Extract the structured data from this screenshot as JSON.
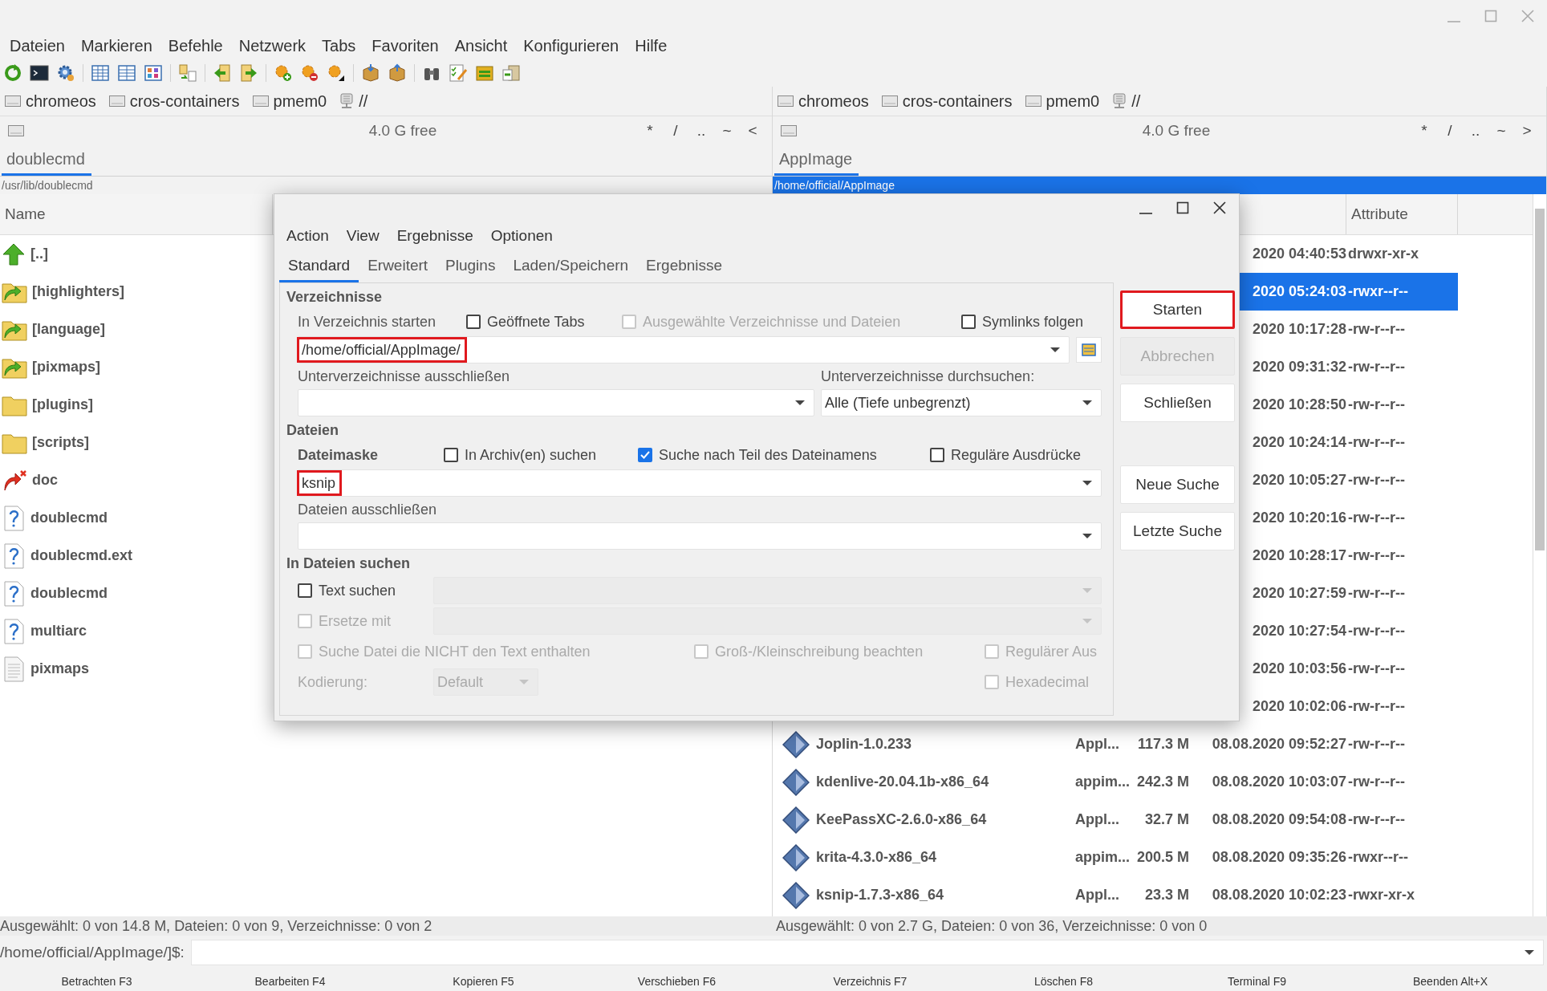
{
  "menu": [
    "Dateien",
    "Markieren",
    "Befehle",
    "Netzwerk",
    "Tabs",
    "Favoriten",
    "Ansicht",
    "Konfigurieren",
    "Hilfe"
  ],
  "panels": [
    {
      "active": false,
      "drives": [
        {
          "label": "chromeos",
          "kind": "disk"
        },
        {
          "label": "cros-containers",
          "kind": "disk"
        },
        {
          "label": "pmem0",
          "kind": "disk"
        },
        {
          "label": "//",
          "kind": "network"
        }
      ],
      "free": "4.0 G free",
      "nav_buttons": [
        "*",
        "/",
        "..",
        "~",
        "<"
      ],
      "tab": "doublecmd",
      "path": "/usr/lib/doublecmd",
      "column": "Name",
      "status": "Ausgewählt: 0 von 14.8 M, Dateien: 0 von 9, Verzeichnisse: 0 von 2",
      "rows": [
        {
          "kind": "parent",
          "name": "[..]",
          "selected": false
        },
        {
          "kind": "folder-link",
          "name": "[highlighters]",
          "selected": false
        },
        {
          "kind": "folder-link",
          "name": "[language]",
          "selected": false
        },
        {
          "kind": "folder-link",
          "name": "[pixmaps]",
          "selected": false
        },
        {
          "kind": "folder",
          "name": "[plugins]",
          "selected": false
        },
        {
          "kind": "folder",
          "name": "[scripts]",
          "selected": false
        },
        {
          "kind": "broken-link",
          "name": "doc",
          "selected": false
        },
        {
          "kind": "file",
          "name": "doublecmd",
          "selected": false
        },
        {
          "kind": "file",
          "name": "doublecmd.ext",
          "selected": false
        },
        {
          "kind": "file",
          "name": "doublecmd",
          "selected": false
        },
        {
          "kind": "file",
          "name": "multiarc",
          "selected": false
        },
        {
          "kind": "text-file",
          "name": "pixmaps",
          "selected": false
        }
      ]
    },
    {
      "active": true,
      "drives": [
        {
          "label": "chromeos",
          "kind": "disk"
        },
        {
          "label": "cros-containers",
          "kind": "disk"
        },
        {
          "label": "pmem0",
          "kind": "disk"
        },
        {
          "label": "//",
          "kind": "network"
        }
      ],
      "free": "4.0 G free",
      "nav_buttons": [
        "*",
        "/",
        "..",
        "~",
        ">"
      ],
      "tab": "AppImage",
      "path": "/home/official/AppImage",
      "column": "Attribute",
      "status": "Ausgewählt: 0 von 2.7 G, Dateien: 0 von 36, Verzeichnisse: 0 von 0",
      "rows": [
        {
          "kind": "covered",
          "modified": "2020 04:40:53",
          "attributes": "drwxr-xr-x",
          "selected": false
        },
        {
          "kind": "covered",
          "modified": "2020 05:24:03",
          "attributes": "-rwxr--r--",
          "selected": true
        },
        {
          "kind": "covered",
          "modified": "2020 10:17:28",
          "attributes": "-rw-r--r--",
          "selected": false
        },
        {
          "kind": "covered",
          "modified": "2020 09:31:32",
          "attributes": "-rw-r--r--",
          "selected": false
        },
        {
          "kind": "covered",
          "modified": "2020 10:28:50",
          "attributes": "-rw-r--r--",
          "selected": false
        },
        {
          "kind": "covered",
          "modified": "2020 10:24:14",
          "attributes": "-rw-r--r--",
          "selected": false
        },
        {
          "kind": "covered",
          "modified": "2020 10:05:27",
          "attributes": "-rw-r--r--",
          "selected": false
        },
        {
          "kind": "covered",
          "modified": "2020 10:20:16",
          "attributes": "-rw-r--r--",
          "selected": false
        },
        {
          "kind": "covered",
          "modified": "2020 10:28:17",
          "attributes": "-rw-r--r--",
          "selected": false
        },
        {
          "kind": "covered",
          "modified": "2020 10:27:59",
          "attributes": "-rw-r--r--",
          "selected": false
        },
        {
          "kind": "covered",
          "modified": "2020 10:27:54",
          "attributes": "-rw-r--r--",
          "selected": false
        },
        {
          "kind": "covered",
          "modified": "2020 10:03:56",
          "attributes": "-rw-r--r--",
          "selected": false
        },
        {
          "kind": "covered",
          "modified": "2020 10:02:06",
          "attributes": "-rw-r--r--",
          "selected": false
        },
        {
          "kind": "appimage",
          "name": "Joplin-1.0.233",
          "type": "Appl...",
          "size": "117.3 M",
          "modified": "08.08.2020 09:52:27",
          "attributes": "-rw-r--r--",
          "selected": false
        },
        {
          "kind": "appimage",
          "name": "kdenlive-20.04.1b-x86_64",
          "type": "appim...",
          "size": "242.3 M",
          "modified": "08.08.2020 10:03:07",
          "attributes": "-rw-r--r--",
          "selected": false
        },
        {
          "kind": "appimage",
          "name": "KeePassXC-2.6.0-x86_64",
          "type": "Appl...",
          "size": "32.7 M",
          "modified": "08.08.2020 09:54:08",
          "attributes": "-rw-r--r--",
          "selected": false
        },
        {
          "kind": "appimage",
          "name": "krita-4.3.0-x86_64",
          "type": "appim...",
          "size": "200.5 M",
          "modified": "08.08.2020 09:35:26",
          "attributes": "-rwxr--r--",
          "selected": false
        },
        {
          "kind": "appimage",
          "name": "ksnip-1.7.3-x86_64",
          "type": "Appl...",
          "size": "23.3 M",
          "modified": "08.08.2020 10:02:23",
          "attributes": "-rwxr-xr-x",
          "selected": false
        }
      ]
    }
  ],
  "command_line": {
    "prompt": "/home/official/AppImage/]$:"
  },
  "function_keys": [
    "Betrachten F3",
    "Bearbeiten F4",
    "Kopieren F5",
    "Verschieben F6",
    "Verzeichnis F7",
    "Löschen F8",
    "Terminal F9",
    "Beenden Alt+X"
  ],
  "dialog": {
    "menu": [
      "Action",
      "View",
      "Ergebnisse",
      "Optionen"
    ],
    "tabs": [
      {
        "label": "Standard",
        "selected": true
      },
      {
        "label": "Erweitert",
        "selected": false
      },
      {
        "label": "Plugins",
        "selected": false
      },
      {
        "label": "Laden/Speichern",
        "selected": false
      },
      {
        "label": "Ergebnisse",
        "selected": false
      }
    ],
    "directories": {
      "title": "Verzeichnisse",
      "start_label": "In Verzeichnis starten",
      "options": [
        {
          "label": "Geöffnete Tabs",
          "checked": false,
          "disabled": false
        },
        {
          "label": "Ausgewählte Verzeichnisse und Dateien",
          "checked": false,
          "disabled": true
        },
        {
          "label": "Symlinks folgen",
          "checked": false,
          "disabled": false
        }
      ],
      "start_path": {
        "value": "/home/official/AppImage/",
        "highlighted": true
      },
      "exclude_label": "Unterverzeichnisse ausschließen",
      "depth_label": "Unterverzeichnisse durchsuchen:",
      "depth": "Alle (Tiefe unbegrenzt)"
    },
    "files": {
      "title": "Dateien",
      "mask_label": "Dateimaske",
      "options": [
        {
          "label": "In Archiv(en) suchen",
          "checked": false,
          "disabled": false
        },
        {
          "label": "Suche nach Teil des Dateinamens",
          "checked": true,
          "disabled": false
        },
        {
          "label": "Reguläre Ausdrücke",
          "checked": false,
          "disabled": false
        }
      ],
      "mask": {
        "value": "ksnip",
        "highlighted": true
      },
      "exclude_label": "Dateien ausschließen"
    },
    "content": {
      "title": "In Dateien suchen",
      "find_text": {
        "label": "Text suchen",
        "checked": false,
        "disabled": false,
        "field_disabled": true
      },
      "replace": {
        "label": "Ersetze mit",
        "checked": false,
        "disabled": true,
        "field_disabled": true
      },
      "options": [
        {
          "label": "Suche Datei die NICHT den Text enthalten",
          "checked": false,
          "disabled": true
        },
        {
          "label": "Groß-/Kleinschreibung beachten",
          "checked": false,
          "disabled": true
        },
        {
          "label": "Regulärer Aus",
          "checked": false,
          "disabled": true
        }
      ],
      "encoding": {
        "label": "Kodierung:",
        "value": "Default",
        "disabled": true
      },
      "hexadecimal": {
        "label": "Hexadecimal",
        "checked": false,
        "disabled": true
      }
    },
    "actions": [
      {
        "label": "Starten",
        "disabled": false,
        "highlighted": true
      },
      {
        "label": "Abbrechen",
        "disabled": true,
        "highlighted": false
      },
      {
        "label": "Schließen",
        "disabled": false,
        "highlighted": false
      }
    ],
    "search_buttons": [
      {
        "label": "Neue Suche",
        "disabled": false,
        "highlighted": false
      },
      {
        "label": "Letzte Suche",
        "disabled": false,
        "highlighted": false
      }
    ]
  }
}
